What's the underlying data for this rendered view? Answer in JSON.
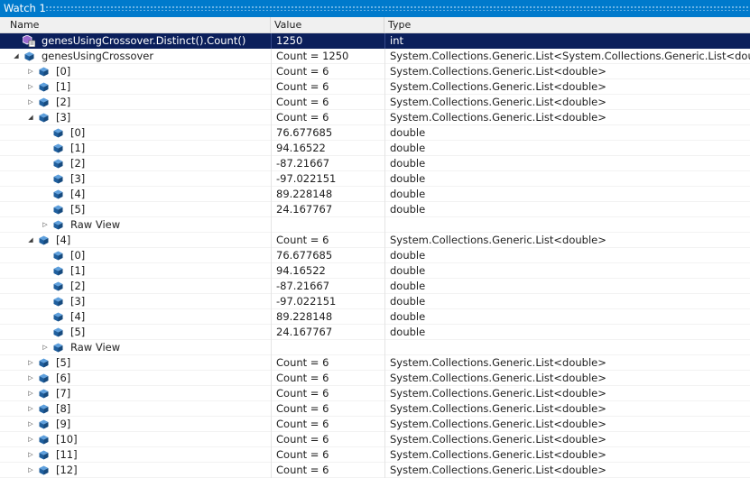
{
  "window": {
    "title": "Watch 1"
  },
  "columns": {
    "name": "Name",
    "value": "Value",
    "type": "Type"
  },
  "colors": {
    "title_bar": "#007acc",
    "selected_row": "#0b1f5b",
    "icon_blue": "#1f5f9e"
  },
  "rows": [
    {
      "name": "genesUsingCrossover.Distinct().Count()",
      "value": "1250",
      "type": "int",
      "depth": 0,
      "toggle": "none",
      "icon": "method-icon",
      "selected": true
    },
    {
      "name": "genesUsingCrossover",
      "value": "Count = 1250",
      "type": "System.Collections.Generic.List<System.Collections.Generic.List<double>>",
      "depth": 0,
      "toggle": "expanded",
      "icon": "field-icon"
    },
    {
      "name": "[0]",
      "value": "Count = 6",
      "type": "System.Collections.Generic.List<double>",
      "depth": 1,
      "toggle": "collapsed",
      "icon": "field-icon"
    },
    {
      "name": "[1]",
      "value": "Count = 6",
      "type": "System.Collections.Generic.List<double>",
      "depth": 1,
      "toggle": "collapsed",
      "icon": "field-icon"
    },
    {
      "name": "[2]",
      "value": "Count = 6",
      "type": "System.Collections.Generic.List<double>",
      "depth": 1,
      "toggle": "collapsed",
      "icon": "field-icon"
    },
    {
      "name": "[3]",
      "value": "Count = 6",
      "type": "System.Collections.Generic.List<double>",
      "depth": 1,
      "toggle": "expanded",
      "icon": "field-icon"
    },
    {
      "name": "[0]",
      "value": "76.677685",
      "type": "double",
      "depth": 2,
      "toggle": "none",
      "icon": "field-icon"
    },
    {
      "name": "[1]",
      "value": "94.16522",
      "type": "double",
      "depth": 2,
      "toggle": "none",
      "icon": "field-icon"
    },
    {
      "name": "[2]",
      "value": "-87.21667",
      "type": "double",
      "depth": 2,
      "toggle": "none",
      "icon": "field-icon"
    },
    {
      "name": "[3]",
      "value": "-97.022151",
      "type": "double",
      "depth": 2,
      "toggle": "none",
      "icon": "field-icon"
    },
    {
      "name": "[4]",
      "value": "89.228148",
      "type": "double",
      "depth": 2,
      "toggle": "none",
      "icon": "field-icon"
    },
    {
      "name": "[5]",
      "value": "24.167767",
      "type": "double",
      "depth": 2,
      "toggle": "none",
      "icon": "field-icon"
    },
    {
      "name": "Raw View",
      "value": "",
      "type": "",
      "depth": 2,
      "toggle": "collapsed",
      "icon": "field-icon"
    },
    {
      "name": "[4]",
      "value": "Count = 6",
      "type": "System.Collections.Generic.List<double>",
      "depth": 1,
      "toggle": "expanded",
      "icon": "field-icon"
    },
    {
      "name": "[0]",
      "value": "76.677685",
      "type": "double",
      "depth": 2,
      "toggle": "none",
      "icon": "field-icon"
    },
    {
      "name": "[1]",
      "value": "94.16522",
      "type": "double",
      "depth": 2,
      "toggle": "none",
      "icon": "field-icon"
    },
    {
      "name": "[2]",
      "value": "-87.21667",
      "type": "double",
      "depth": 2,
      "toggle": "none",
      "icon": "field-icon"
    },
    {
      "name": "[3]",
      "value": "-97.022151",
      "type": "double",
      "depth": 2,
      "toggle": "none",
      "icon": "field-icon"
    },
    {
      "name": "[4]",
      "value": "89.228148",
      "type": "double",
      "depth": 2,
      "toggle": "none",
      "icon": "field-icon"
    },
    {
      "name": "[5]",
      "value": "24.167767",
      "type": "double",
      "depth": 2,
      "toggle": "none",
      "icon": "field-icon"
    },
    {
      "name": "Raw View",
      "value": "",
      "type": "",
      "depth": 2,
      "toggle": "collapsed",
      "icon": "field-icon"
    },
    {
      "name": "[5]",
      "value": "Count = 6",
      "type": "System.Collections.Generic.List<double>",
      "depth": 1,
      "toggle": "collapsed",
      "icon": "field-icon"
    },
    {
      "name": "[6]",
      "value": "Count = 6",
      "type": "System.Collections.Generic.List<double>",
      "depth": 1,
      "toggle": "collapsed",
      "icon": "field-icon"
    },
    {
      "name": "[7]",
      "value": "Count = 6",
      "type": "System.Collections.Generic.List<double>",
      "depth": 1,
      "toggle": "collapsed",
      "icon": "field-icon"
    },
    {
      "name": "[8]",
      "value": "Count = 6",
      "type": "System.Collections.Generic.List<double>",
      "depth": 1,
      "toggle": "collapsed",
      "icon": "field-icon"
    },
    {
      "name": "[9]",
      "value": "Count = 6",
      "type": "System.Collections.Generic.List<double>",
      "depth": 1,
      "toggle": "collapsed",
      "icon": "field-icon"
    },
    {
      "name": "[10]",
      "value": "Count = 6",
      "type": "System.Collections.Generic.List<double>",
      "depth": 1,
      "toggle": "collapsed",
      "icon": "field-icon"
    },
    {
      "name": "[11]",
      "value": "Count = 6",
      "type": "System.Collections.Generic.List<double>",
      "depth": 1,
      "toggle": "collapsed",
      "icon": "field-icon"
    },
    {
      "name": "[12]",
      "value": "Count = 6",
      "type": "System.Collections.Generic.List<double>",
      "depth": 1,
      "toggle": "collapsed",
      "icon": "field-icon"
    }
  ]
}
